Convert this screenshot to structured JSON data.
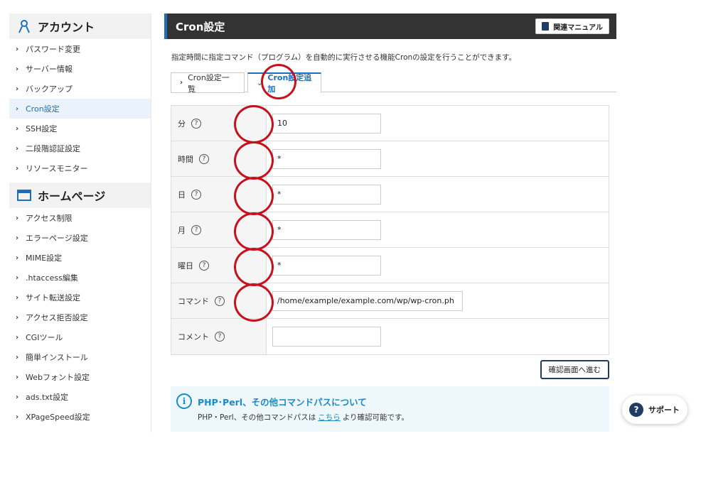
{
  "sidebar": {
    "account": {
      "title": "アカウント",
      "items": [
        {
          "label": "パスワード変更"
        },
        {
          "label": "サーバー情報"
        },
        {
          "label": "バックアップ"
        },
        {
          "label": "Cron設定"
        },
        {
          "label": "SSH設定"
        },
        {
          "label": "二段階認証設定"
        },
        {
          "label": "リソースモニター"
        }
      ]
    },
    "homepage": {
      "title": "ホームページ",
      "items": [
        {
          "label": "アクセス制限"
        },
        {
          "label": "エラーページ設定"
        },
        {
          "label": "MIME設定"
        },
        {
          "label": ".htaccess編集"
        },
        {
          "label": "サイト転送設定"
        },
        {
          "label": "アクセス拒否設定"
        },
        {
          "label": "CGIツール"
        },
        {
          "label": "簡単インストール"
        },
        {
          "label": "Webフォント設定"
        },
        {
          "label": "ads.txt設定"
        },
        {
          "label": "XPageSpeed設定"
        }
      ]
    },
    "active": "Cron設定"
  },
  "header": {
    "title": "Cron設定",
    "manual_label": "関連マニュアル"
  },
  "description": "指定時間に指定コマンド（プログラム）を自動的に実行させる機能Cronの設定を行うことができます。",
  "tabs": [
    {
      "label": "Cron設定一覧",
      "active": false
    },
    {
      "label": "Cron設定追加",
      "active": true
    }
  ],
  "form": {
    "help_glyph": "?",
    "fields": [
      {
        "label": "分",
        "value": "10"
      },
      {
        "label": "時間",
        "value": "*"
      },
      {
        "label": "日",
        "value": "*"
      },
      {
        "label": "月",
        "value": "*"
      },
      {
        "label": "曜日",
        "value": "*"
      },
      {
        "label": "コマンド",
        "value": "/home/example/example.com/wp/wp-cron.ph"
      },
      {
        "label": "コメント",
        "value": ""
      }
    ]
  },
  "confirm_label": "確認画面へ進む",
  "info": {
    "title": "PHP･Perl、その他コマンドパスについて",
    "body_pre": "PHP・Perl、その他コマンドパスは",
    "link": "こちら",
    "body_post": "より確認可能です。"
  },
  "support_label": "サポート",
  "colors": {
    "accent": "#1a6fc2",
    "header_bg": "#333333",
    "annotation": "#c8101c"
  }
}
